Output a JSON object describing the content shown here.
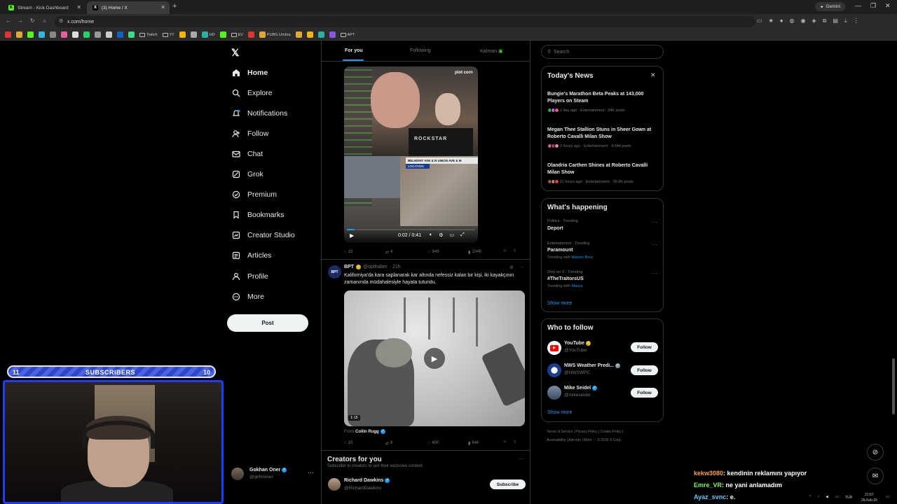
{
  "browser": {
    "tabs": [
      {
        "label": "Stream - Kick Dashboard",
        "icon": "kick-icon"
      },
      {
        "label": "(3) Home / X",
        "icon": "x-icon"
      }
    ],
    "url": "x.com/home",
    "gemini_label": "Gemini",
    "bookmarks": [
      "Twitch",
      "YT",
      "HD",
      "EV",
      "PUBG Umbra",
      "APT"
    ]
  },
  "nav": {
    "items": [
      {
        "label": "Home",
        "icon": "home-icon"
      },
      {
        "label": "Explore",
        "icon": "search-icon"
      },
      {
        "label": "Notifications",
        "icon": "bell-icon"
      },
      {
        "label": "Follow",
        "icon": "person-add-icon"
      },
      {
        "label": "Chat",
        "icon": "mail-icon"
      },
      {
        "label": "Grok",
        "icon": "grok-icon"
      },
      {
        "label": "Premium",
        "icon": "x-premium-icon"
      },
      {
        "label": "Bookmarks",
        "icon": "bookmark-icon"
      },
      {
        "label": "Creator Studio",
        "icon": "creator-icon"
      },
      {
        "label": "Articles",
        "icon": "article-icon"
      },
      {
        "label": "Profile",
        "icon": "person-icon"
      },
      {
        "label": "More",
        "icon": "more-circle-icon"
      }
    ],
    "post_label": "Post",
    "account": {
      "name": "Gokhan Oner",
      "handle": "@gkhnoner"
    }
  },
  "timeline": {
    "tabs": [
      "For you",
      "Following",
      "Katman"
    ],
    "tweet1": {
      "video_time": "0:02 / 0:41",
      "overlay_banner": "BELMONT AVE & N UNION AVE & M",
      "overlay_location": "LOCATION",
      "overlay_shirt": "ROCKSTAR",
      "overlay_logo": "plot corn",
      "replies": "15",
      "reposts": "4",
      "likes": "949",
      "views": "104K"
    },
    "tweet2": {
      "name": "BPT",
      "handle": "@opthaber",
      "time": "· 21h",
      "avatar_text": "BPT",
      "text": "Kaliforniya'da kara saplanarak kar altında nefessiz kalan bir kişi, iki kayakçının zamanında müdahalesiyle hayata tutundu.",
      "duration": "1:15",
      "from_label": "From",
      "from_name": "Collin Rugg",
      "replies": "15",
      "reposts": "8",
      "likes": "450",
      "views": "64K"
    },
    "creators": {
      "title": "Creators for you",
      "subtitle": "Subscribe to creators to see their exclusive content.",
      "name": "Richard Dawkins",
      "handle": "@RichardDawkins",
      "button": "Subscribe"
    }
  },
  "sidebar": {
    "search_placeholder": "Search",
    "news": {
      "title": "Today's News",
      "items": [
        {
          "headline": "Bungie's Marathon Beta Peaks at 143,000 Players on Steam",
          "meta": "1 day ago · Entertainment · 34K posts"
        },
        {
          "headline": "Megan Thee Stallion Stuns in Sheer Gown at Roberto Cavalli Milan Show",
          "meta": "2 hours ago · Entertainment · 4,044 posts"
        },
        {
          "headline": "Olandria Carthen Shines at Roberto Cavalli Milan Show",
          "meta": "11 hours ago · Entertainment · 56.8K posts"
        }
      ]
    },
    "happening": {
      "title": "What's happening",
      "items": [
        {
          "meta": "Politics · Trending",
          "name": "Deport",
          "sub_prefix": "",
          "sub_link": ""
        },
        {
          "meta": "Entertainment · Trending",
          "name": "Paramount",
          "sub_prefix": "Trending with ",
          "sub_link": "Warner Bros"
        },
        {
          "meta": "Only on X · Trending",
          "name": "#TheTraitorsUS",
          "sub_prefix": "Trending with ",
          "sub_link": "Maura"
        }
      ],
      "show_more": "Show more"
    },
    "who_to_follow": {
      "title": "Who to follow",
      "items": [
        {
          "name": "YouTube",
          "handle": "@YouTube",
          "button": "Follow"
        },
        {
          "name": "NWS Weather Predi...",
          "handle": "@NWSWPC",
          "button": "Follow"
        },
        {
          "name": "Mike Seidel",
          "handle": "@mikeseidel",
          "button": "Follow"
        }
      ],
      "show_more": "Show more"
    },
    "footer": {
      "line1": "Terms of Service  |  Privacy Policy  |  Cookie Policy  |",
      "line2": "Accessibility  |  Ads info  |  More ···  © 2026 X Corp."
    }
  },
  "overlay": {
    "sub_left": "11",
    "sub_center": "SUBSCRIBERS",
    "sub_right": "10",
    "chat": [
      {
        "user": "kekw3080",
        "msg": ": kendinin reklamını yapıyor"
      },
      {
        "user": "Emre_VR",
        "msg": ": ne yani anlamadım"
      },
      {
        "user": "Ayaz_svnc",
        "msg": ": e."
      }
    ]
  },
  "taskbar": {
    "lang": "TUR",
    "time": "21:57",
    "date": "26-Feb-26"
  }
}
